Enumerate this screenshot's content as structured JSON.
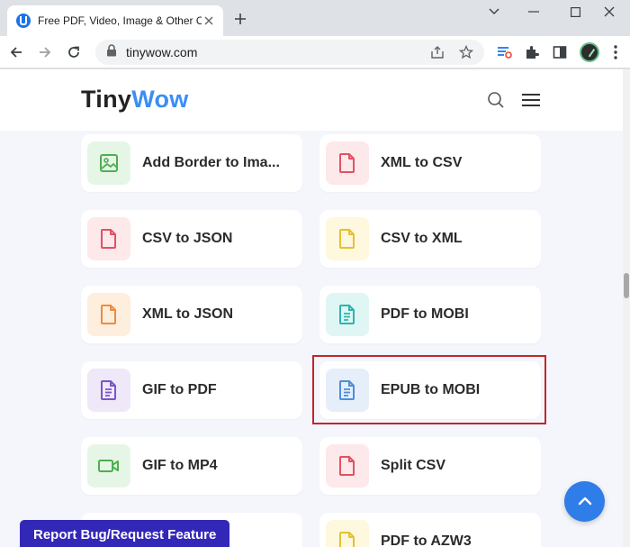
{
  "browser": {
    "tab_title": "Free PDF, Video, Image & Other Online Tools - TinyWow",
    "url": "tinywow.com",
    "icons": {
      "tab_close": "close-icon",
      "new_tab": "plus-icon",
      "minimize": "minimize-icon",
      "maximize": "maximize-icon",
      "close_window": "close-icon",
      "back": "arrow-left-icon",
      "forward": "arrow-right-icon",
      "reload": "reload-icon",
      "lock": "lock-icon",
      "share": "share-icon",
      "bookmark": "star-icon"
    }
  },
  "site": {
    "logo_part1": "Tiny",
    "logo_part2": "Wow",
    "logo_colors": {
      "tiny": "#222222",
      "wow": "#3a8ef6"
    }
  },
  "tools": [
    {
      "label": "Add Border to Ima...",
      "icon": "image-icon",
      "icon_color": "#4caf50",
      "icon_bg": "#e6f6e6"
    },
    {
      "label": "XML to CSV",
      "icon": "file-icon",
      "icon_color": "#e05263",
      "icon_bg": "#fde8ea"
    },
    {
      "label": "CSV to JSON",
      "icon": "file-icon",
      "icon_color": "#e05263",
      "icon_bg": "#fde8ea"
    },
    {
      "label": "CSV to XML",
      "icon": "file-icon",
      "icon_color": "#e5c033",
      "icon_bg": "#fdf8de"
    },
    {
      "label": "XML to JSON",
      "icon": "file-icon",
      "icon_color": "#f08a3c",
      "icon_bg": "#fdeede"
    },
    {
      "label": "PDF to MOBI",
      "icon": "document-icon",
      "icon_color": "#2cb5ad",
      "icon_bg": "#e0f6f4"
    },
    {
      "label": "GIF to PDF",
      "icon": "document-icon",
      "icon_color": "#7b55c7",
      "icon_bg": "#eee8f9"
    },
    {
      "label": "EPUB to MOBI",
      "icon": "document-icon",
      "icon_color": "#4a8fde",
      "icon_bg": "#e6eef9"
    },
    {
      "label": "GIF to MP4",
      "icon": "video-icon",
      "icon_color": "#4caf50",
      "icon_bg": "#e6f6e6"
    },
    {
      "label": "Split CSV",
      "icon": "file-icon",
      "icon_color": "#e05263",
      "icon_bg": "#fde8ea"
    },
    {
      "label": "",
      "icon": "file-icon",
      "icon_color": "#f08a3c",
      "icon_bg": "#fdeede"
    },
    {
      "label": "PDF to AZW3",
      "icon": "file-icon",
      "icon_color": "#e5c033",
      "icon_bg": "#fdf8de"
    }
  ],
  "highlighted_tool": "EPUB to MOBI",
  "highlight_color": "#c0272d",
  "report_button": "Report Bug/Request Feature",
  "report_color": "#3327b8",
  "scroll_top_color": "#2f7de9"
}
